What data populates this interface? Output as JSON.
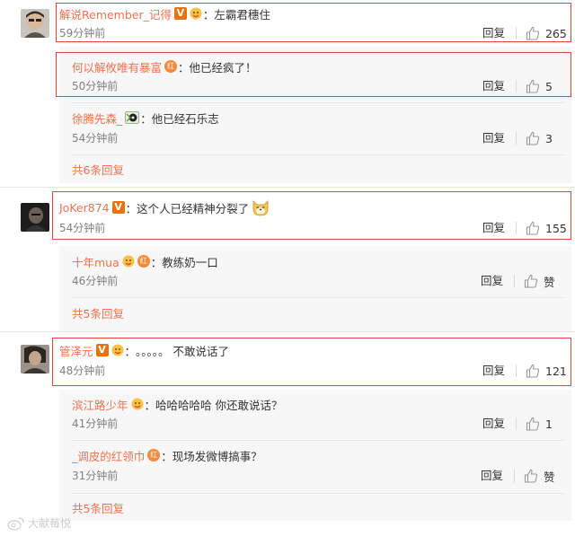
{
  "comments": [
    {
      "user": "解说Remember_记得",
      "text": "左霸君穗住",
      "time": "59分钟前",
      "reply": "回复",
      "likes": "265",
      "replies": [
        {
          "user": "何以解攸唯有暴富",
          "text": "他已经疯了！",
          "time": "50分钟前",
          "reply": "回复",
          "likes": "5"
        },
        {
          "user": "徐腾先森_",
          "text": "他已经石乐志",
          "time": "54分钟前",
          "reply": "回复",
          "likes": "3"
        }
      ],
      "more": "共6条回复"
    },
    {
      "user": "JoKer874",
      "text": "这个人已经精神分裂了",
      "time": "54分钟前",
      "reply": "回复",
      "likes": "155",
      "replies": [
        {
          "user": "十年mua",
          "text": "教练奶一口",
          "time": "46分钟前",
          "reply": "回复",
          "likes": "赞"
        }
      ],
      "more": "共5条回复"
    },
    {
      "user": "管泽元",
      "text": "。。。。。 不敢说话了",
      "time": "48分钟前",
      "reply": "回复",
      "likes": "121",
      "replies": [
        {
          "user": "滨江路少年",
          "text": "哈哈哈哈哈 你还敢说话？",
          "time": "41分钟前",
          "reply": "回复",
          "likes": "1"
        },
        {
          "user": "_调皮的红领巾",
          "text": "现场发微博搞事？",
          "time": "31分钟前",
          "reply": "回复",
          "likes": "赞"
        }
      ],
      "more": "共5条回复"
    }
  ],
  "badge_v": "V",
  "badge_hong": "红",
  "colon": "：",
  "watermark": "大献莓悦",
  "colors": {
    "username": "#eb7350",
    "highlight": "#e7423b",
    "time": "#808080"
  },
  "icons": [
    "thumbs-up-icon",
    "face-badge-icon",
    "hong-badge-icon",
    "disc-badge-icon",
    "dog-emoji-icon",
    "weibo-watermark-icon"
  ]
}
